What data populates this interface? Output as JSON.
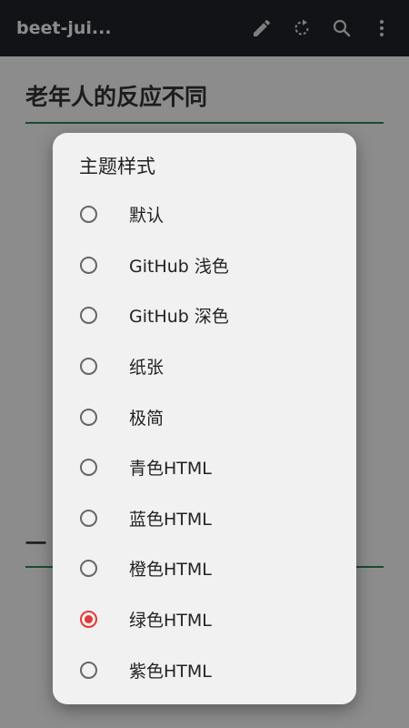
{
  "app_bar": {
    "title": "beet-jui...",
    "actions": [
      {
        "icon": "pencil-icon"
      },
      {
        "icon": "rotate-icon"
      },
      {
        "icon": "search-icon"
      },
      {
        "icon": "more-vert-icon"
      }
    ]
  },
  "article": {
    "heading1": "老年人的反应不同",
    "heading2": "一"
  },
  "dialog": {
    "title": "主题样式",
    "selected_index": 8,
    "options": [
      {
        "label": "默认"
      },
      {
        "label": "GitHub 浅色"
      },
      {
        "label": "GitHub 深色"
      },
      {
        "label": "纸张"
      },
      {
        "label": "极简"
      },
      {
        "label": "青色HTML"
      },
      {
        "label": "蓝色HTML"
      },
      {
        "label": "橙色HTML"
      },
      {
        "label": "绿色HTML"
      },
      {
        "label": "紫色HTML"
      }
    ]
  },
  "colors": {
    "app_bar_bg": "#1f2329",
    "dialog_bg": "#f1f1f1",
    "accent_red": "#e53935",
    "heading_rule": "#2e8b57"
  }
}
